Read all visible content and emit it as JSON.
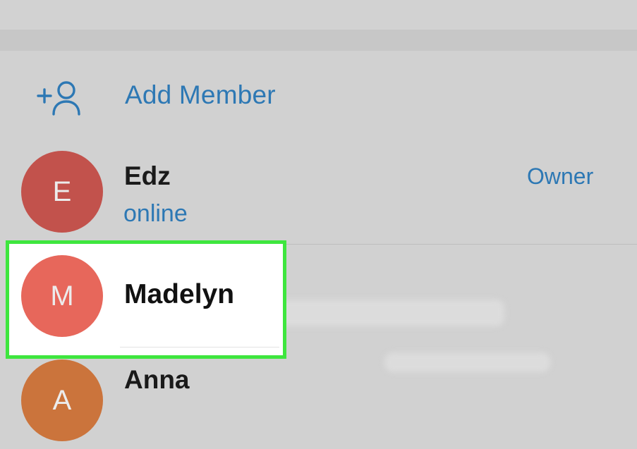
{
  "add_member": {
    "label": "Add Member",
    "icon": "add-user-icon"
  },
  "members": [
    {
      "initial": "E",
      "name": "Edz",
      "status": "online",
      "role": "Owner",
      "avatar_color": "#c2524c"
    },
    {
      "initial": "M",
      "name": "Madelyn",
      "status": "",
      "role": "",
      "avatar_color": "#e7675b",
      "highlighted": true
    },
    {
      "initial": "A",
      "name": "Anna",
      "status": "",
      "role": "",
      "avatar_color": "#cb743c"
    }
  ],
  "colors": {
    "accent": "#2d78b4",
    "highlight_border": "#3ee63e",
    "background": "#d1d1d1"
  }
}
